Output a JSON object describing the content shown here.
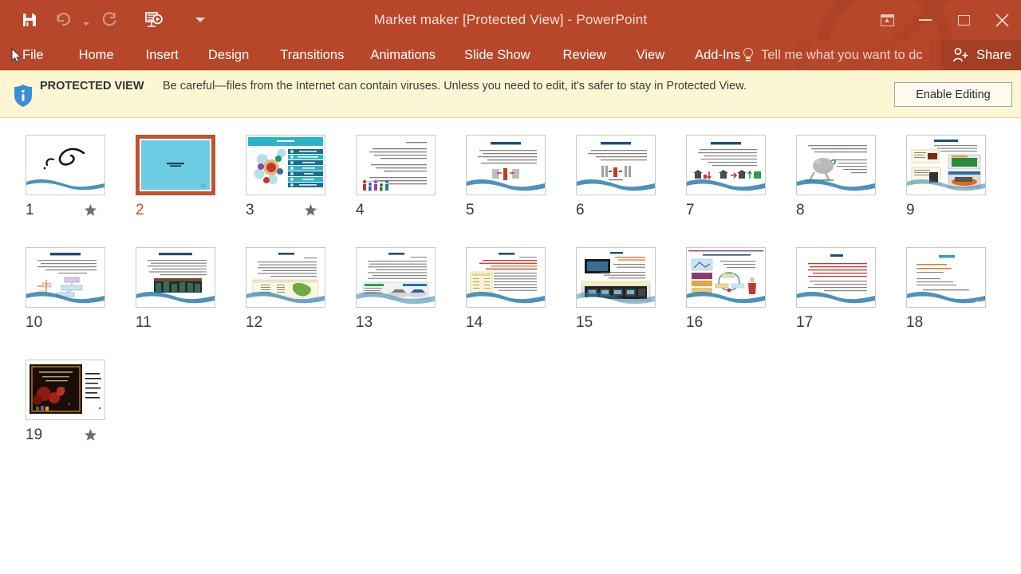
{
  "window": {
    "title": "Market maker [Protected View] - PowerPoint",
    "accent_color": "#b7472a",
    "controls": {
      "ribbon_display_options": "ribbon-display-options",
      "minimize": "minimize",
      "maximize": "maximize",
      "close": "✕"
    }
  },
  "quick_access": {
    "save": "save",
    "undo": "undo",
    "undo_dropdown": "undo-dropdown",
    "redo": "redo",
    "start_slideshow": "start-from-beginning",
    "customize": "customize-quick-access-toolbar"
  },
  "menu": {
    "items": [
      {
        "label": "File"
      },
      {
        "label": "Home"
      },
      {
        "label": "Insert"
      },
      {
        "label": "Design"
      },
      {
        "label": "Transitions"
      },
      {
        "label": "Animations"
      },
      {
        "label": "Slide Show"
      },
      {
        "label": "Review"
      },
      {
        "label": "View"
      },
      {
        "label": "Add-Ins"
      }
    ],
    "tell_me": "Tell me what you want to dc",
    "share": "Share"
  },
  "protected_view": {
    "label": "PROTECTED VIEW",
    "message": "Be careful—files from the Internet can contain viruses. Unless you need to edit, it's safer to stay in Protected View.",
    "enable_button": "Enable Editing",
    "bar_color": "#fcf6d4"
  },
  "sorter": {
    "selected_slide": 2,
    "selection_color": "#c0522e",
    "slides": [
      {
        "number": "1",
        "kind": "calligraphy",
        "has_transition_star": true
      },
      {
        "number": "2",
        "kind": "cyan-title",
        "has_transition_star": false
      },
      {
        "number": "3",
        "kind": "cyan-diagram",
        "has_transition_star": true
      },
      {
        "number": "4",
        "kind": "text-people",
        "has_transition_star": false
      },
      {
        "number": "5",
        "kind": "titled-text",
        "has_transition_star": false
      },
      {
        "number": "6",
        "kind": "titled-chart",
        "has_transition_star": false
      },
      {
        "number": "7",
        "kind": "titled-icons",
        "has_transition_star": false
      },
      {
        "number": "8",
        "kind": "cartoon",
        "has_transition_star": false
      },
      {
        "number": "9",
        "kind": "photo-grid",
        "has_transition_star": false
      },
      {
        "number": "10",
        "kind": "org-chart",
        "has_transition_star": false
      },
      {
        "number": "11",
        "kind": "market-photo",
        "has_transition_star": false
      },
      {
        "number": "12",
        "kind": "iran-map",
        "has_transition_star": false
      },
      {
        "number": "13",
        "kind": "cars-screen",
        "has_transition_star": false
      },
      {
        "number": "14",
        "kind": "yellow-box",
        "has_transition_star": false
      },
      {
        "number": "15",
        "kind": "dark-screens",
        "has_transition_star": false
      },
      {
        "number": "16",
        "kind": "cycle-person",
        "has_transition_star": false
      },
      {
        "number": "17",
        "kind": "red-text",
        "has_transition_star": false
      },
      {
        "number": "18",
        "kind": "sources",
        "has_transition_star": false
      },
      {
        "number": "19",
        "kind": "yalda",
        "has_transition_star": true
      }
    ]
  }
}
